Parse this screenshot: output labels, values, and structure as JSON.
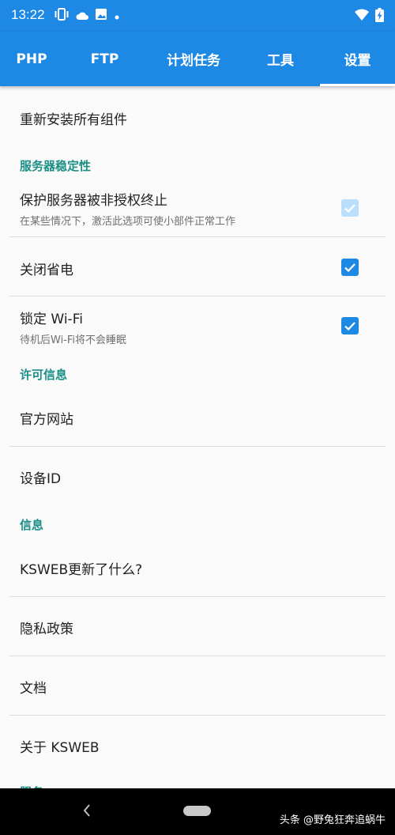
{
  "status": {
    "time": "13:22"
  },
  "tabs": [
    {
      "label": "PHP",
      "active": false
    },
    {
      "label": "FTP",
      "active": false
    },
    {
      "label": "计划任务",
      "active": false
    },
    {
      "label": "工具",
      "active": false
    },
    {
      "label": "设置",
      "active": true
    }
  ],
  "settings": {
    "reinstall": "重新安装所有组件",
    "server_stability": {
      "header": "服务器稳定性",
      "protect": {
        "title": "保护服务器被非授权终止",
        "subtitle": "在某些情况下，激活此选项可使小部件正常工作",
        "checked": true,
        "enabled": false
      },
      "power_off": {
        "title": "关闭省电",
        "checked": true,
        "enabled": true
      },
      "wifi_lock": {
        "title": "锁定 Wi-Fi",
        "subtitle": "待机后Wi-Fi将不会睡眠",
        "checked": true,
        "enabled": true
      }
    },
    "license": {
      "header": "许可信息",
      "website": "官方网站",
      "device_id": "设备ID"
    },
    "info": {
      "header": "信息",
      "whats_new": "KSWEB更新了什么?",
      "privacy": "隐私政策",
      "docs": "文档",
      "about": "关于 KSWEB",
      "next_header_partial": "服务"
    }
  },
  "watermark": "头条 @野兔狂奔追蜗牛",
  "colors": {
    "primary": "#1e88e5",
    "section": "#1b8f86"
  }
}
